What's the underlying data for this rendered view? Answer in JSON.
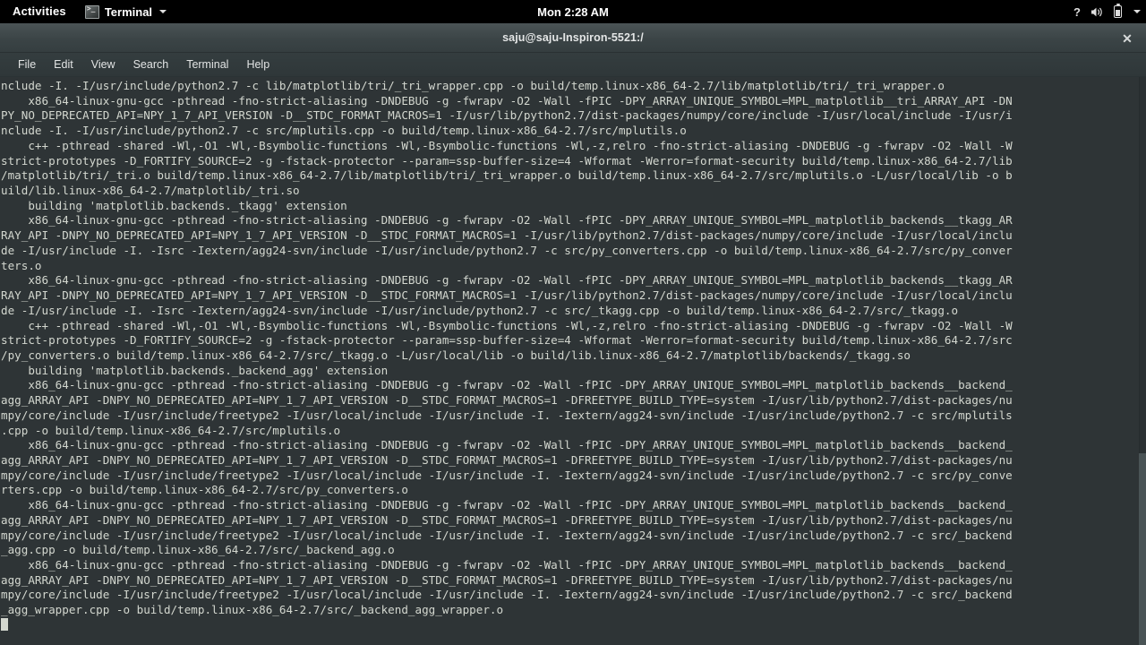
{
  "topbar": {
    "activities": "Activities",
    "app_name": "Terminal",
    "clock": "Mon 2:28 AM",
    "icons": {
      "app": "terminal-icon",
      "app_caret": "chevron-down-icon",
      "help": "?",
      "volume": "volume-icon",
      "battery": "battery-icon",
      "system_caret": "chevron-down-icon"
    }
  },
  "window": {
    "title": "saju@saju-Inspiron-5521:/",
    "close_label": "✕",
    "menu": [
      "File",
      "Edit",
      "View",
      "Search",
      "Terminal",
      "Help"
    ]
  },
  "terminal": {
    "cursor": "block-cursor",
    "lines": [
      "nclude -I. -I/usr/include/python2.7 -c lib/matplotlib/tri/_tri_wrapper.cpp -o build/temp.linux-x86_64-2.7/lib/matplotlib/tri/_tri_wrapper.o",
      "    x86_64-linux-gnu-gcc -pthread -fno-strict-aliasing -DNDEBUG -g -fwrapv -O2 -Wall -fPIC -DPY_ARRAY_UNIQUE_SYMBOL=MPL_matplotlib__tri_ARRAY_API -DN",
      "PY_NO_DEPRECATED_API=NPY_1_7_API_VERSION -D__STDC_FORMAT_MACROS=1 -I/usr/lib/python2.7/dist-packages/numpy/core/include -I/usr/local/include -I/usr/i",
      "nclude -I. -I/usr/include/python2.7 -c src/mplutils.cpp -o build/temp.linux-x86_64-2.7/src/mplutils.o",
      "    c++ -pthread -shared -Wl,-O1 -Wl,-Bsymbolic-functions -Wl,-Bsymbolic-functions -Wl,-z,relro -fno-strict-aliasing -DNDEBUG -g -fwrapv -O2 -Wall -W",
      "strict-prototypes -D_FORTIFY_SOURCE=2 -g -fstack-protector --param=ssp-buffer-size=4 -Wformat -Werror=format-security build/temp.linux-x86_64-2.7/lib",
      "/matplotlib/tri/_tri.o build/temp.linux-x86_64-2.7/lib/matplotlib/tri/_tri_wrapper.o build/temp.linux-x86_64-2.7/src/mplutils.o -L/usr/local/lib -o b",
      "uild/lib.linux-x86_64-2.7/matplotlib/_tri.so",
      "    building 'matplotlib.backends._tkagg' extension",
      "    x86_64-linux-gnu-gcc -pthread -fno-strict-aliasing -DNDEBUG -g -fwrapv -O2 -Wall -fPIC -DPY_ARRAY_UNIQUE_SYMBOL=MPL_matplotlib_backends__tkagg_AR",
      "RAY_API -DNPY_NO_DEPRECATED_API=NPY_1_7_API_VERSION -D__STDC_FORMAT_MACROS=1 -I/usr/lib/python2.7/dist-packages/numpy/core/include -I/usr/local/inclu",
      "de -I/usr/include -I. -Isrc -Iextern/agg24-svn/include -I/usr/include/python2.7 -c src/py_converters.cpp -o build/temp.linux-x86_64-2.7/src/py_conver",
      "ters.o",
      "    x86_64-linux-gnu-gcc -pthread -fno-strict-aliasing -DNDEBUG -g -fwrapv -O2 -Wall -fPIC -DPY_ARRAY_UNIQUE_SYMBOL=MPL_matplotlib_backends__tkagg_AR",
      "RAY_API -DNPY_NO_DEPRECATED_API=NPY_1_7_API_VERSION -D__STDC_FORMAT_MACROS=1 -I/usr/lib/python2.7/dist-packages/numpy/core/include -I/usr/local/inclu",
      "de -I/usr/include -I. -Isrc -Iextern/agg24-svn/include -I/usr/include/python2.7 -c src/_tkagg.cpp -o build/temp.linux-x86_64-2.7/src/_tkagg.o",
      "    c++ -pthread -shared -Wl,-O1 -Wl,-Bsymbolic-functions -Wl,-Bsymbolic-functions -Wl,-z,relro -fno-strict-aliasing -DNDEBUG -g -fwrapv -O2 -Wall -W",
      "strict-prototypes -D_FORTIFY_SOURCE=2 -g -fstack-protector --param=ssp-buffer-size=4 -Wformat -Werror=format-security build/temp.linux-x86_64-2.7/src",
      "/py_converters.o build/temp.linux-x86_64-2.7/src/_tkagg.o -L/usr/local/lib -o build/lib.linux-x86_64-2.7/matplotlib/backends/_tkagg.so",
      "    building 'matplotlib.backends._backend_agg' extension",
      "    x86_64-linux-gnu-gcc -pthread -fno-strict-aliasing -DNDEBUG -g -fwrapv -O2 -Wall -fPIC -DPY_ARRAY_UNIQUE_SYMBOL=MPL_matplotlib_backends__backend_",
      "agg_ARRAY_API -DNPY_NO_DEPRECATED_API=NPY_1_7_API_VERSION -D__STDC_FORMAT_MACROS=1 -DFREETYPE_BUILD_TYPE=system -I/usr/lib/python2.7/dist-packages/nu",
      "mpy/core/include -I/usr/include/freetype2 -I/usr/local/include -I/usr/include -I. -Iextern/agg24-svn/include -I/usr/include/python2.7 -c src/mplutils",
      ".cpp -o build/temp.linux-x86_64-2.7/src/mplutils.o",
      "    x86_64-linux-gnu-gcc -pthread -fno-strict-aliasing -DNDEBUG -g -fwrapv -O2 -Wall -fPIC -DPY_ARRAY_UNIQUE_SYMBOL=MPL_matplotlib_backends__backend_",
      "agg_ARRAY_API -DNPY_NO_DEPRECATED_API=NPY_1_7_API_VERSION -D__STDC_FORMAT_MACROS=1 -DFREETYPE_BUILD_TYPE=system -I/usr/lib/python2.7/dist-packages/nu",
      "mpy/core/include -I/usr/include/freetype2 -I/usr/local/include -I/usr/include -I. -Iextern/agg24-svn/include -I/usr/include/python2.7 -c src/py_conve",
      "rters.cpp -o build/temp.linux-x86_64-2.7/src/py_converters.o",
      "    x86_64-linux-gnu-gcc -pthread -fno-strict-aliasing -DNDEBUG -g -fwrapv -O2 -Wall -fPIC -DPY_ARRAY_UNIQUE_SYMBOL=MPL_matplotlib_backends__backend_",
      "agg_ARRAY_API -DNPY_NO_DEPRECATED_API=NPY_1_7_API_VERSION -D__STDC_FORMAT_MACROS=1 -DFREETYPE_BUILD_TYPE=system -I/usr/lib/python2.7/dist-packages/nu",
      "mpy/core/include -I/usr/include/freetype2 -I/usr/local/include -I/usr/include -I. -Iextern/agg24-svn/include -I/usr/include/python2.7 -c src/_backend",
      "_agg.cpp -o build/temp.linux-x86_64-2.7/src/_backend_agg.o",
      "    x86_64-linux-gnu-gcc -pthread -fno-strict-aliasing -DNDEBUG -g -fwrapv -O2 -Wall -fPIC -DPY_ARRAY_UNIQUE_SYMBOL=MPL_matplotlib_backends__backend_",
      "agg_ARRAY_API -DNPY_NO_DEPRECATED_API=NPY_1_7_API_VERSION -D__STDC_FORMAT_MACROS=1 -DFREETYPE_BUILD_TYPE=system -I/usr/lib/python2.7/dist-packages/nu",
      "mpy/core/include -I/usr/include/freetype2 -I/usr/local/include -I/usr/include -I. -Iextern/agg24-svn/include -I/usr/include/python2.7 -c src/_backend",
      "_agg_wrapper.cpp -o build/temp.linux-x86_64-2.7/src/_backend_agg_wrapper.o"
    ]
  },
  "colors": {
    "topbar_bg": "#000000",
    "terminal_bg": "#2e3436",
    "terminal_fg": "#d3d7cf",
    "titlebar_bg": "#3b4446"
  }
}
